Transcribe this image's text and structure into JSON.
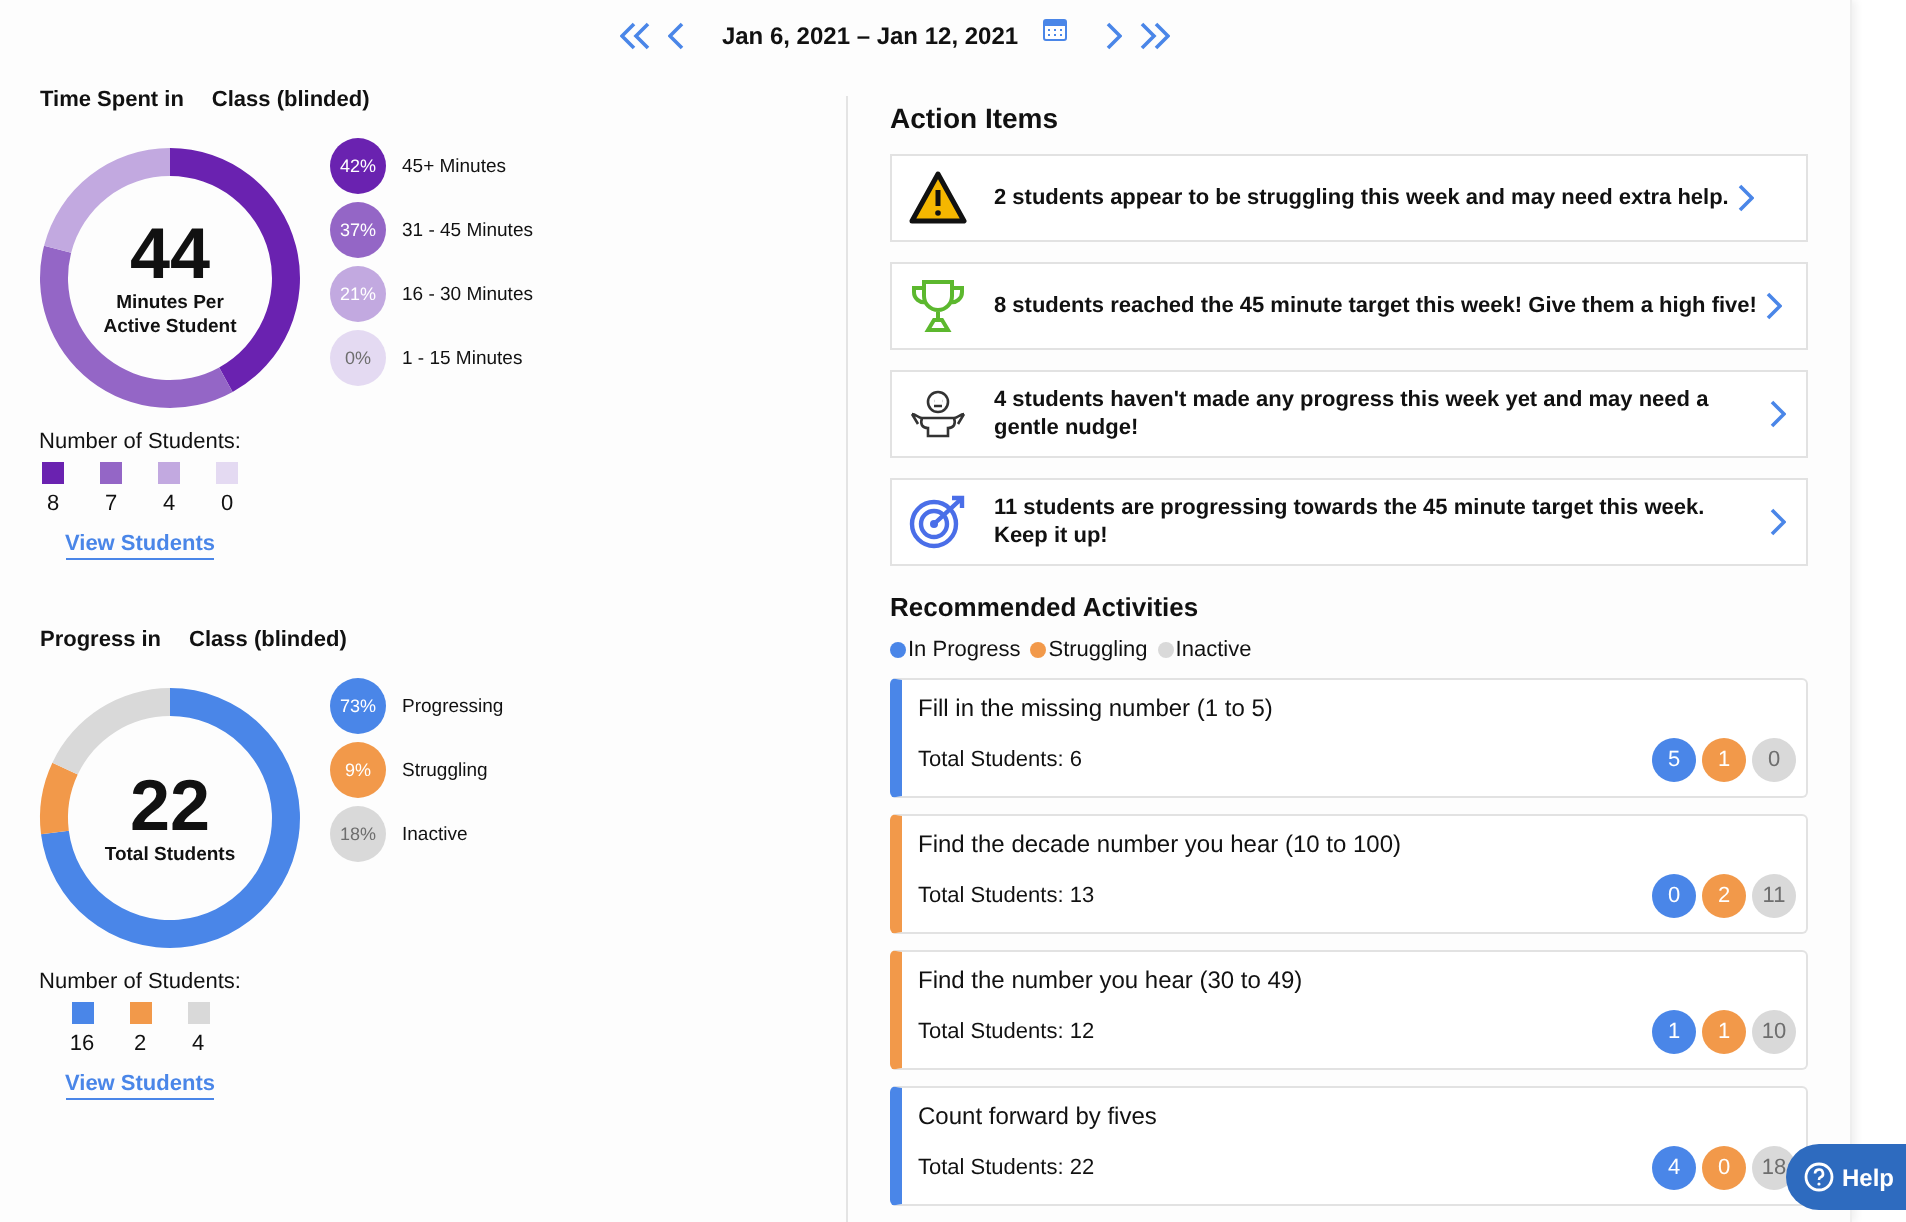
{
  "date_nav": {
    "range": "Jan 6, 2021 – Jan 12, 2021"
  },
  "time_panel": {
    "title": "Time Spent in",
    "class_name": "Class (blinded)",
    "center_value": "44",
    "center_caption": "Minutes Per Active Student",
    "legend": [
      {
        "percent": "42%",
        "color": "#6a22b0"
      },
      {
        "percent": "37%",
        "color": "#9466c6"
      },
      {
        "percent": "21%",
        "color": "#c2a9e0"
      },
      {
        "percent": "0%",
        "color": "#e4daf2"
      }
    ],
    "chart_data": {
      "type": "donut",
      "categories": [
        "45+ Minutes",
        "31 - 45 Minutes",
        "16 - 30 Minutes",
        "1 - 15 Minutes"
      ],
      "values": [
        42,
        37,
        21,
        0
      ]
    },
    "counts_label": "Number of Students:",
    "counts": [
      {
        "value": "8",
        "color": "#6a22b0"
      },
      {
        "value": "7",
        "color": "#9466c6"
      },
      {
        "value": "4",
        "color": "#c2a9e0"
      },
      {
        "value": "0",
        "color": "#e4daf2"
      }
    ],
    "link": "View Students"
  },
  "progress_panel": {
    "title": "Progress in",
    "class_name": "Class (blinded)",
    "center_value": "22",
    "center_caption": "Total Students",
    "legend": [
      {
        "percent": "73%",
        "color": "#4a86e8"
      },
      {
        "percent": "9%",
        "color": "#f2994a"
      },
      {
        "percent": "18%",
        "color": "#d9d9d9"
      }
    ],
    "chart_data": {
      "type": "donut",
      "categories": [
        "Progressing",
        "Struggling",
        "Inactive"
      ],
      "values": [
        73,
        9,
        18
      ]
    },
    "counts_label": "Number of Students:",
    "counts": [
      {
        "value": "16",
        "color": "#4a86e8"
      },
      {
        "value": "2",
        "color": "#f2994a"
      },
      {
        "value": "4",
        "color": "#d9d9d9"
      }
    ],
    "link": "View Students"
  },
  "action_items": {
    "title": "Action Items",
    "items": [
      {
        "kind": "warning",
        "text": "2 students appear to be struggling this week and may need extra help."
      },
      {
        "kind": "trophy",
        "text": "8 students reached the 45 minute target this week! Give them a high five!"
      },
      {
        "kind": "shrug",
        "text": "4 students haven't made any progress this week yet and may need a gentle nudge!"
      },
      {
        "kind": "target",
        "text": "11 students are progressing towards the 45 minute target this week. Keep it up!"
      }
    ]
  },
  "recommended": {
    "title": "Recommended Activities",
    "legend": [
      {
        "label": "In Progress",
        "color": "#4a86e8"
      },
      {
        "label": "Struggling",
        "color": "#f2994a"
      },
      {
        "label": "Inactive",
        "color": "#d9d9d9"
      }
    ],
    "activities": [
      {
        "title": "Fill in the missing number (1 to 5)",
        "total": "Total Students: 6",
        "color": "#4a86e8",
        "counts": [
          "5",
          "1",
          "0"
        ]
      },
      {
        "title": "Find the decade number you hear (10 to 100)",
        "total": "Total Students: 13",
        "color": "#f2994a",
        "counts": [
          "0",
          "2",
          "11"
        ]
      },
      {
        "title": "Find the number you hear (30 to 49)",
        "total": "Total Students: 12",
        "color": "#f2994a",
        "counts": [
          "1",
          "1",
          "10"
        ]
      },
      {
        "title": "Count forward by fives",
        "total": "Total Students: 22",
        "color": "#4a86e8",
        "counts": [
          "4",
          "0",
          "18"
        ]
      }
    ]
  },
  "help_button": {
    "label": "Help"
  }
}
